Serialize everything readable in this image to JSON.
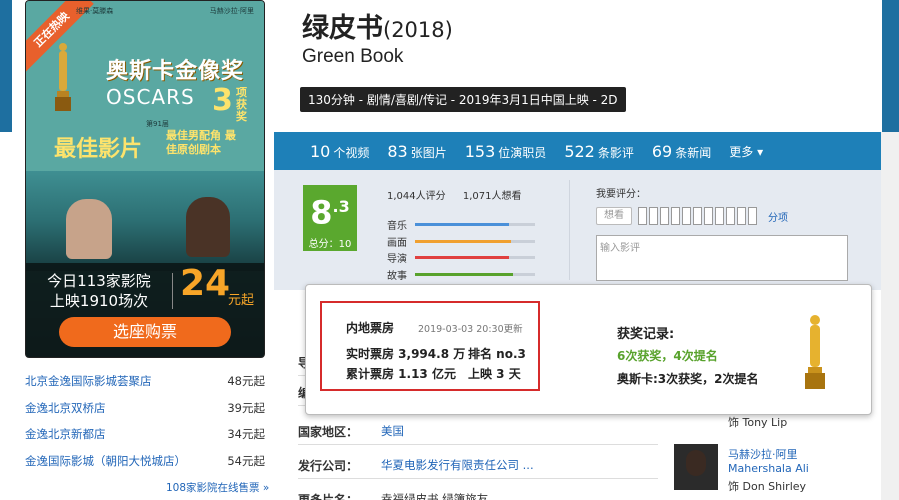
{
  "poster": {
    "ribbon": "正在热映",
    "actor_left": "维果·莫滕森",
    "actor_right": "马赫沙拉·阿里",
    "oscar_title": "奥斯卡金像奖",
    "oscars": "OSCARS",
    "count": "3",
    "count_unit": "项获奖",
    "edition": "第91届",
    "best_picture": "最佳影片",
    "sub_awards": "最佳男配角 最佳原创剧本",
    "today_line1": "今日113家影院",
    "today_line2": "上映1910场次",
    "price": "24",
    "price_unit": "元起",
    "buy_button": "选座购票"
  },
  "cinemas": [
    {
      "name": "北京金逸国际影城荟聚店",
      "price": "48元起"
    },
    {
      "name": "金逸北京双桥店",
      "price": "39元起"
    },
    {
      "name": "金逸北京新都店",
      "price": "34元起"
    },
    {
      "name": "金逸国际影城（朝阳大悦城店）",
      "price": "54元起"
    }
  ],
  "more_cinemas": "108家影院在线售票 »",
  "movie": {
    "title": "绿皮书",
    "year": "(2018)",
    "en_title": "Green Book",
    "meta": "130分钟 - 剧情/喜剧/传记 - 2019年3月1日中国上映 - 2D"
  },
  "stats": [
    {
      "num": "10",
      "label": "个视频"
    },
    {
      "num": "83",
      "label": "张图片"
    },
    {
      "num": "153",
      "label": "位演职员"
    },
    {
      "num": "522",
      "label": "条影评"
    },
    {
      "num": "69",
      "label": "条新闻"
    }
  ],
  "more_label": "更多 ▾",
  "rating": {
    "score_int": "8",
    "score_dec": ".3",
    "total_label": "总分：10",
    "raters": "1,044人评分",
    "wants": "1,071人想看",
    "categories": [
      {
        "label": "音乐",
        "value": 0.78,
        "color": "#4a90d9"
      },
      {
        "label": "画面",
        "value": 0.8,
        "color": "#f0a030"
      },
      {
        "label": "导演",
        "value": 0.78,
        "color": "#e04040"
      },
      {
        "label": "故事",
        "value": 0.82,
        "color": "#58a22c"
      }
    ],
    "my_rating_label": "我要评分：",
    "want_tag": "想看",
    "fen_label": "分项",
    "comment_placeholder": "输入影评"
  },
  "details": [
    {
      "key": "导",
      "value": ""
    },
    {
      "key": "编",
      "value": ""
    },
    {
      "key": "国家地区：",
      "value": "美国"
    },
    {
      "key": "发行公司：",
      "value": "华夏电影发行有限责任公司    ..."
    },
    {
      "key": "更多片名：",
      "value": "幸福绿皮书    绿簿旅友"
    }
  ],
  "cast": [
    {
      "name": "",
      "role": "饰 Tony Lip"
    },
    {
      "name": "马赫沙拉·阿里",
      "en": "Mahershala Ali",
      "role": "饰 Don Shirley"
    }
  ],
  "popup": {
    "box_office_title": "内地票房",
    "updated": "2019-03-03 20:30更新",
    "realtime": "实时票房 3,994.8 万",
    "rank": "排名 no.3",
    "total": "累计票房 1.13 亿元",
    "days": "上映 3 天",
    "awards_title": "获奖记录:",
    "awards_summary": "6次获奖，4次提名",
    "oscar_summary": "奥斯卡:3次获奖，2次提名"
  }
}
